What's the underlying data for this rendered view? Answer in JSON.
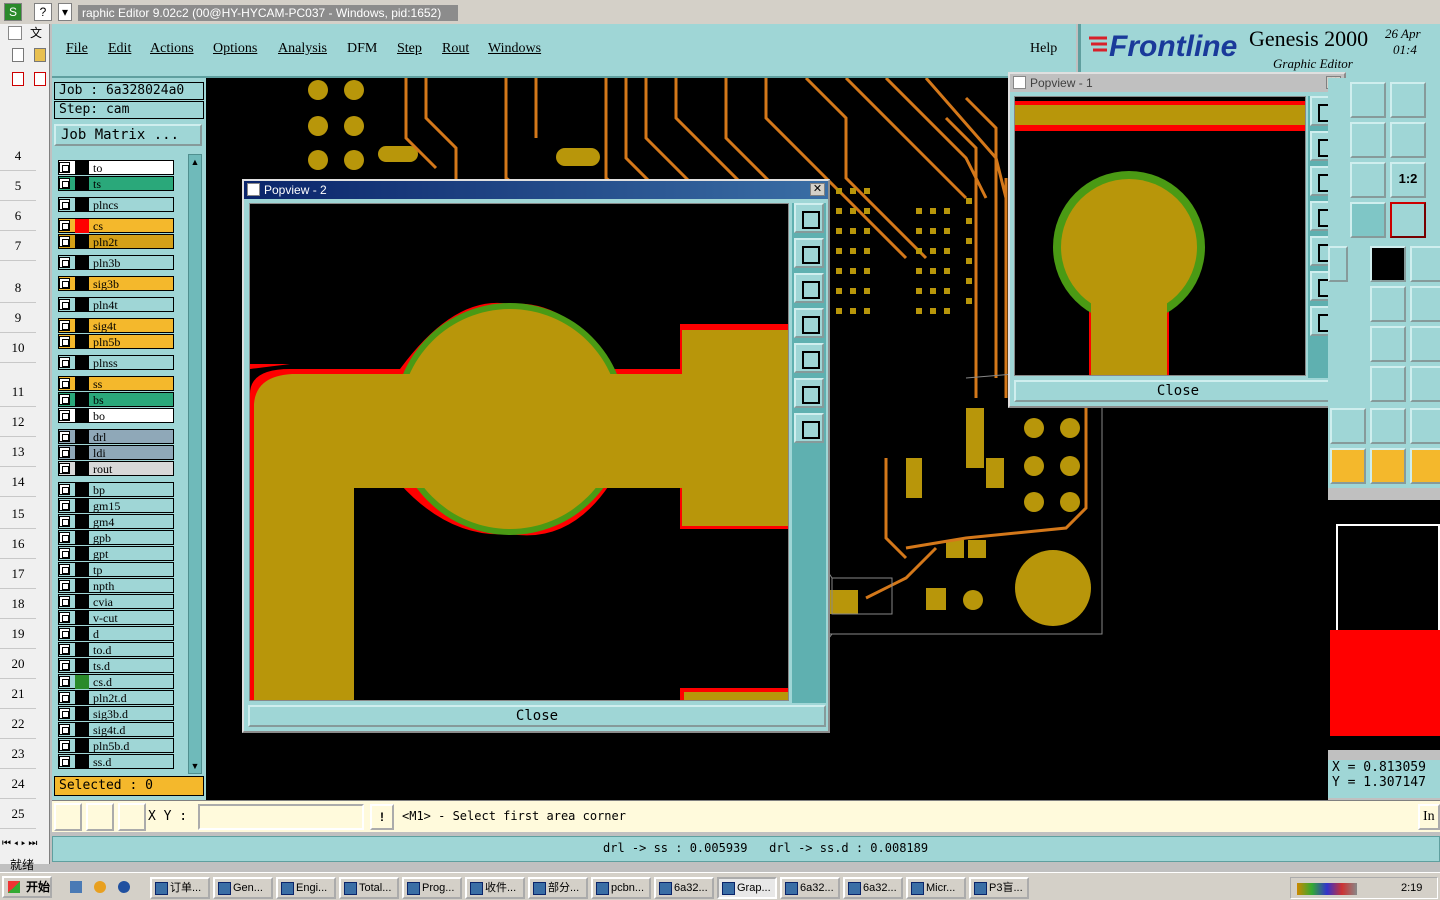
{
  "window": {
    "title": "raphic Editor 9.02c2 (00@HY-HYCAM-PC037 - Windows, pid:1652)"
  },
  "excel": {
    "rows": [
      "4",
      "5",
      "6",
      "7",
      "8",
      "9",
      "10",
      "11",
      "12",
      "13",
      "14",
      "15",
      "16",
      "17",
      "18",
      "19",
      "20",
      "21",
      "22",
      "23",
      "24",
      "25"
    ],
    "status": "就绪"
  },
  "menu": [
    "File",
    "Edit",
    "Actions",
    "Options",
    "Analysis",
    "DFM",
    "Step",
    "Rout",
    "Windows"
  ],
  "help": "Help",
  "brand": {
    "logo": "Frontline",
    "product": "Genesis 2000",
    "subtitle": "Graphic Editor",
    "date": "26 Apr",
    "time": "01:4"
  },
  "job": {
    "job_label": "Job : 6a328024a0",
    "step_label": "Step: cam",
    "matrix_button": "Job Matrix ..."
  },
  "layers": [
    {
      "name": "to",
      "color": "#ffffff"
    },
    {
      "name": "ts",
      "color": "#2aa87a"
    },
    {
      "name": "plncs",
      "color": "#9fd6d6"
    },
    {
      "name": "cs",
      "color": "#f4b82c"
    },
    {
      "name": "pln2t",
      "color": "#d4a017"
    },
    {
      "name": "pln3b",
      "color": "#9fd6d6"
    },
    {
      "name": "sig3b",
      "color": "#f4b82c"
    },
    {
      "name": "pln4t",
      "color": "#9fd6d6"
    },
    {
      "name": "sig4t",
      "color": "#f4b82c"
    },
    {
      "name": "pln5b",
      "color": "#f4b82c"
    },
    {
      "name": "plnss",
      "color": "#9fd6d6"
    },
    {
      "name": "ss",
      "color": "#f4b82c"
    },
    {
      "name": "bs",
      "color": "#2aa87a"
    },
    {
      "name": "bo",
      "color": "#ffffff"
    },
    {
      "name": "drl",
      "color": "#8fa8b8"
    },
    {
      "name": "ldi",
      "color": "#8fa8b8"
    },
    {
      "name": "rout",
      "color": "#d8d8d8"
    },
    {
      "name": "bp",
      "color": "#9fd6d6"
    },
    {
      "name": "gm15",
      "color": "#9fd6d6"
    },
    {
      "name": "gm4",
      "color": "#9fd6d6"
    },
    {
      "name": "gpb",
      "color": "#9fd6d6"
    },
    {
      "name": "gpt",
      "color": "#9fd6d6"
    },
    {
      "name": "tp",
      "color": "#9fd6d6"
    },
    {
      "name": "npth",
      "color": "#9fd6d6"
    },
    {
      "name": "cvia",
      "color": "#9fd6d6"
    },
    {
      "name": "v-cut",
      "color": "#9fd6d6"
    },
    {
      "name": "d",
      "color": "#9fd6d6"
    },
    {
      "name": "to.d",
      "color": "#9fd6d6"
    },
    {
      "name": "ts.d",
      "color": "#9fd6d6"
    },
    {
      "name": "cs.d",
      "color": "#9fd6d6"
    },
    {
      "name": "pln2t.d",
      "color": "#9fd6d6"
    },
    {
      "name": "sig3b.d",
      "color": "#9fd6d6"
    },
    {
      "name": "sig4t.d",
      "color": "#9fd6d6"
    },
    {
      "name": "pln5b.d",
      "color": "#9fd6d6"
    },
    {
      "name": "ss.d",
      "color": "#9fd6d6"
    }
  ],
  "selected": "Selected : 0",
  "popview2": {
    "title": "Popview - 2",
    "close": "Close"
  },
  "popview1": {
    "title": "Popview - 1",
    "close": "Close"
  },
  "coords": {
    "x": "X = 0.813059",
    "y": "Y = 1.307147"
  },
  "scale_label": "1:2",
  "cmd": {
    "xy_label": "X Y :",
    "xy_value": "",
    "prompt": "<M1> - Select first area corner",
    "right_btn": "In"
  },
  "message": "drl -> ss : 0.005939   drl -> ss.d : 0.008189",
  "taskbar": {
    "start": "开始",
    "tasks": [
      "订单...",
      "Gen...",
      "Engi...",
      "Total...",
      "Prog...",
      "收件...",
      "部分...",
      "pcbn...",
      "6a32...",
      "Grap...",
      "6a32...",
      "6a32...",
      "Micr...",
      "P3盲..."
    ],
    "clock": "2:19"
  },
  "colors": {
    "copper": "#b8960a",
    "mask": "#4a9a14",
    "clearance": "#ff0000",
    "panel": "#9fd6d6",
    "trace": "#d4781a"
  }
}
